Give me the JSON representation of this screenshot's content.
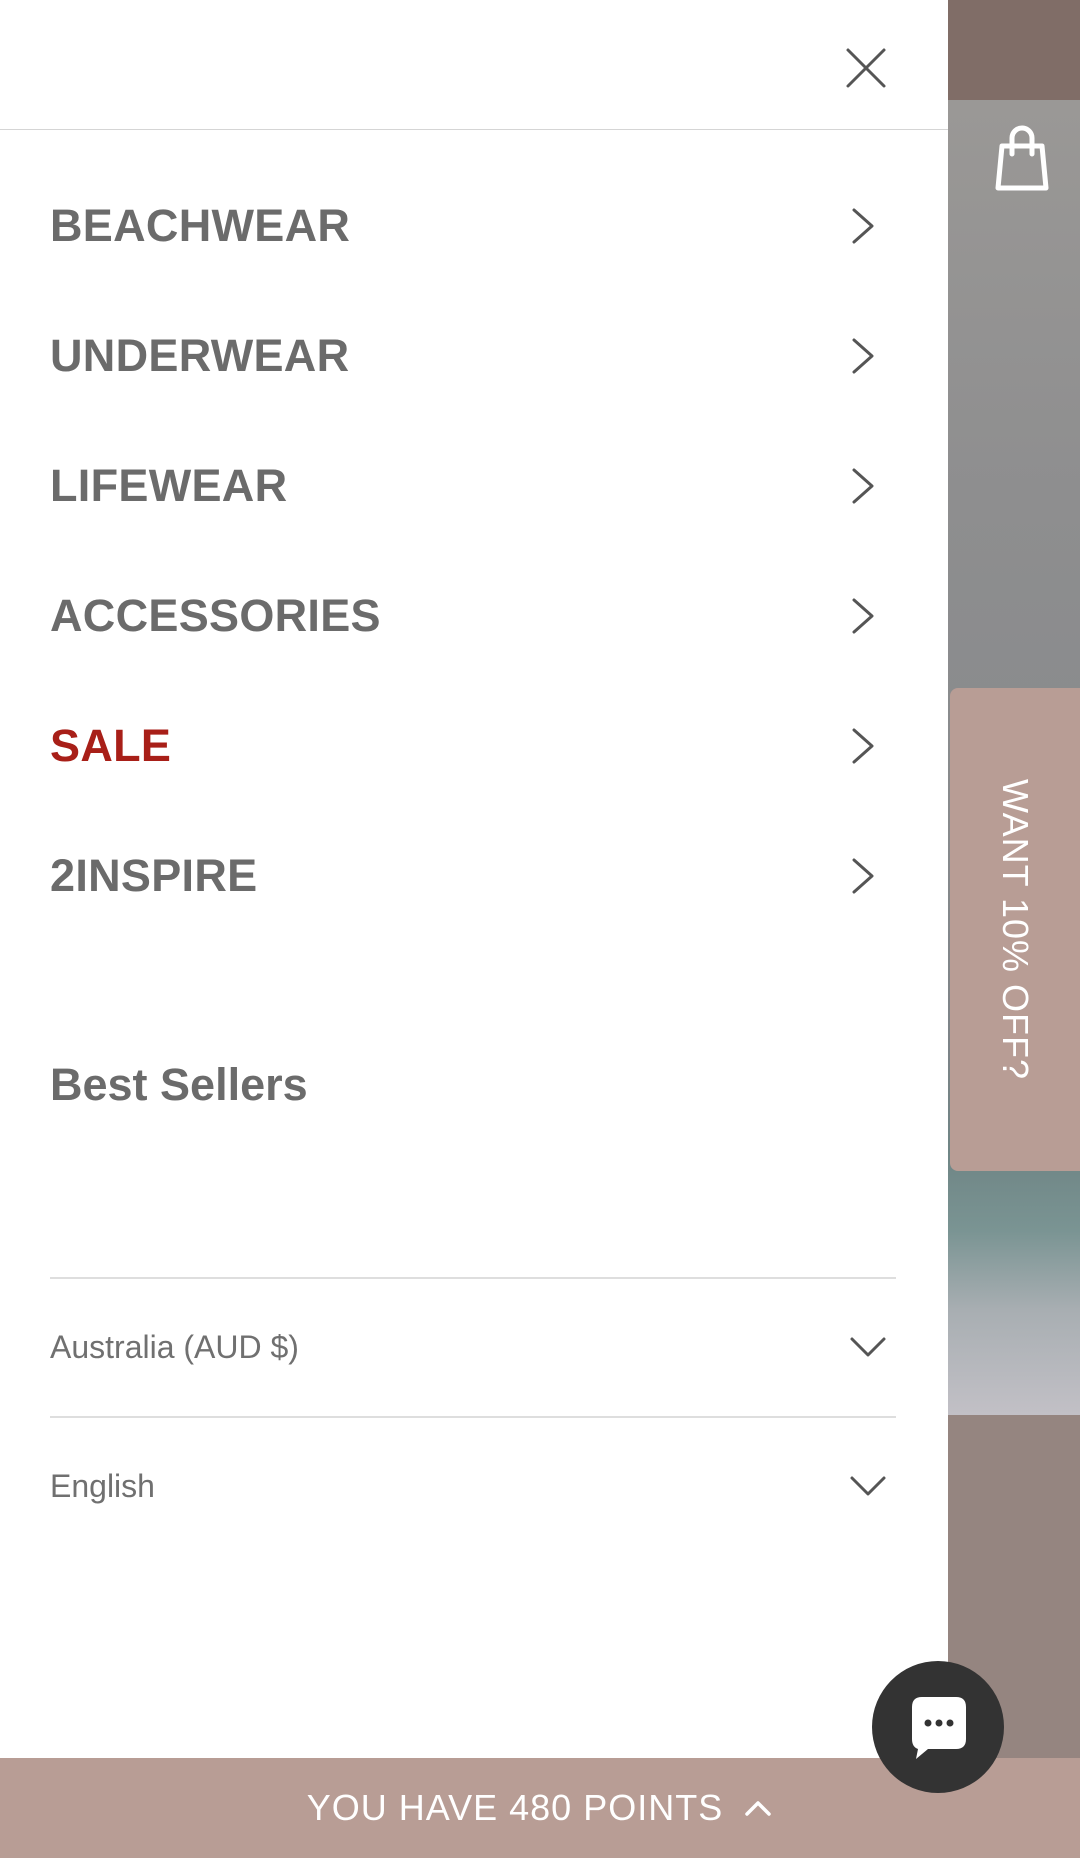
{
  "drawer": {
    "nav_items": [
      {
        "label": "BEACHWEAR"
      },
      {
        "label": "UNDERWEAR"
      },
      {
        "label": "LIFEWEAR"
      },
      {
        "label": "ACCESSORIES"
      },
      {
        "label": "SALE"
      },
      {
        "label": "2INSPIRE"
      }
    ],
    "best_sellers_label": "Best Sellers",
    "country_selector": {
      "value": "Australia (AUD $)"
    },
    "language_selector": {
      "value": "English"
    }
  },
  "promo_tab": {
    "label": "WANT 10% OFF?"
  },
  "points_bar": {
    "label": "YOU HAVE 480 POINTS"
  },
  "icons": {
    "close": "close-icon",
    "bag": "shopping-bag-icon",
    "chevron_right": "chevron-right-icon",
    "chevron_down": "chevron-down-icon",
    "chevron_up": "chevron-up-icon",
    "chat": "chat-bubble-icon"
  },
  "colors": {
    "nav_text": "#6b6b6b",
    "sale_text": "#a81f18",
    "accent_bar": "#b89d95",
    "chat_button": "#333333"
  }
}
